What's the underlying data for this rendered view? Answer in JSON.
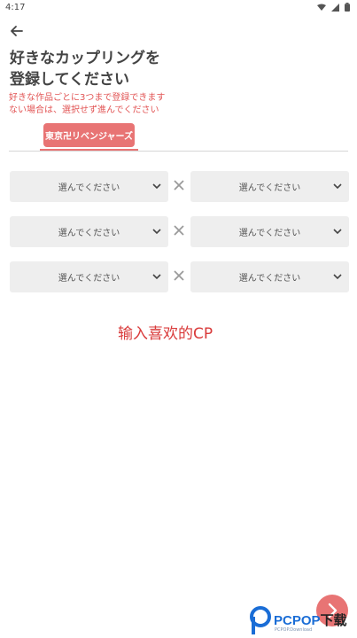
{
  "status_bar": {
    "time": "4:17",
    "icons": [
      "wifi-icon",
      "signal-icon",
      "battery-icon"
    ]
  },
  "header": {
    "back_icon": "arrow-left-icon",
    "title_line1": "好きなカップリングを",
    "title_line2": "登録してください"
  },
  "note": {
    "line1": "好きな作品ごとに3つまで登録できます",
    "line2": "ない場合は、選択せず進んでください"
  },
  "tabs": [
    {
      "label": "東京卍リベンジャーズ",
      "selected": true
    }
  ],
  "pairs": [
    {
      "left": "選んでください",
      "right": "選んでください"
    },
    {
      "left": "選んでください",
      "right": "選んでください"
    },
    {
      "left": "選んでください",
      "right": "選んでください"
    }
  ],
  "overlay_caption": "输入喜欢的CP",
  "fab_icon": "chevron-right-icon",
  "watermark": {
    "brand": "PCPOP",
    "suffix": "下载",
    "sub": "PCPOP.Download"
  },
  "colors": {
    "accent": "#e87474",
    "note": "#e25555",
    "field": "#eeeeee",
    "caption": "#d93a3a"
  }
}
